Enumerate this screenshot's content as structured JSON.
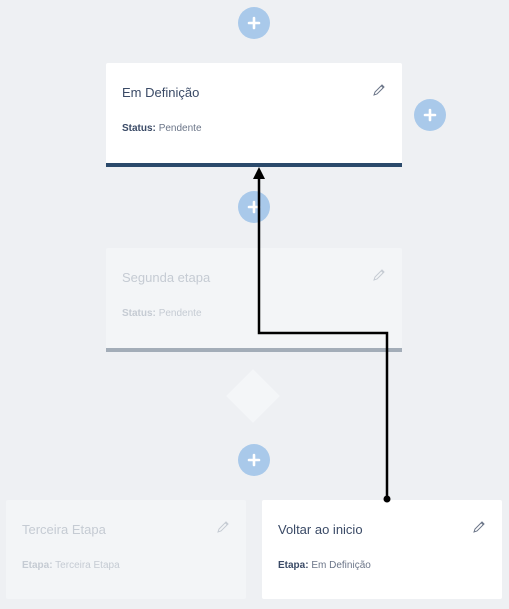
{
  "cards": [
    {
      "id": "em-definicao",
      "title": "Em Definição",
      "meta_key": "Status:",
      "meta_value": "Pendente"
    },
    {
      "id": "segunda-etapa",
      "title": "Segunda etapa",
      "meta_key": "Status:",
      "meta_value": "Pendente"
    },
    {
      "id": "terceira-etapa",
      "title": "Terceira Etapa",
      "meta_key": "Etapa:",
      "meta_value": "Terceira Etapa"
    },
    {
      "id": "voltar-ao-inicio",
      "title": "Voltar ao inicio",
      "meta_key": "Etapa:",
      "meta_value": "Em Definição"
    }
  ],
  "icons": {
    "add": "plus-icon",
    "edit": "pencil-icon"
  },
  "colors": {
    "accent": "#a9c9ea",
    "active_bar": "#2b4a6b",
    "inactive_bar": "#a3adb8",
    "background": "#eef0f3"
  }
}
